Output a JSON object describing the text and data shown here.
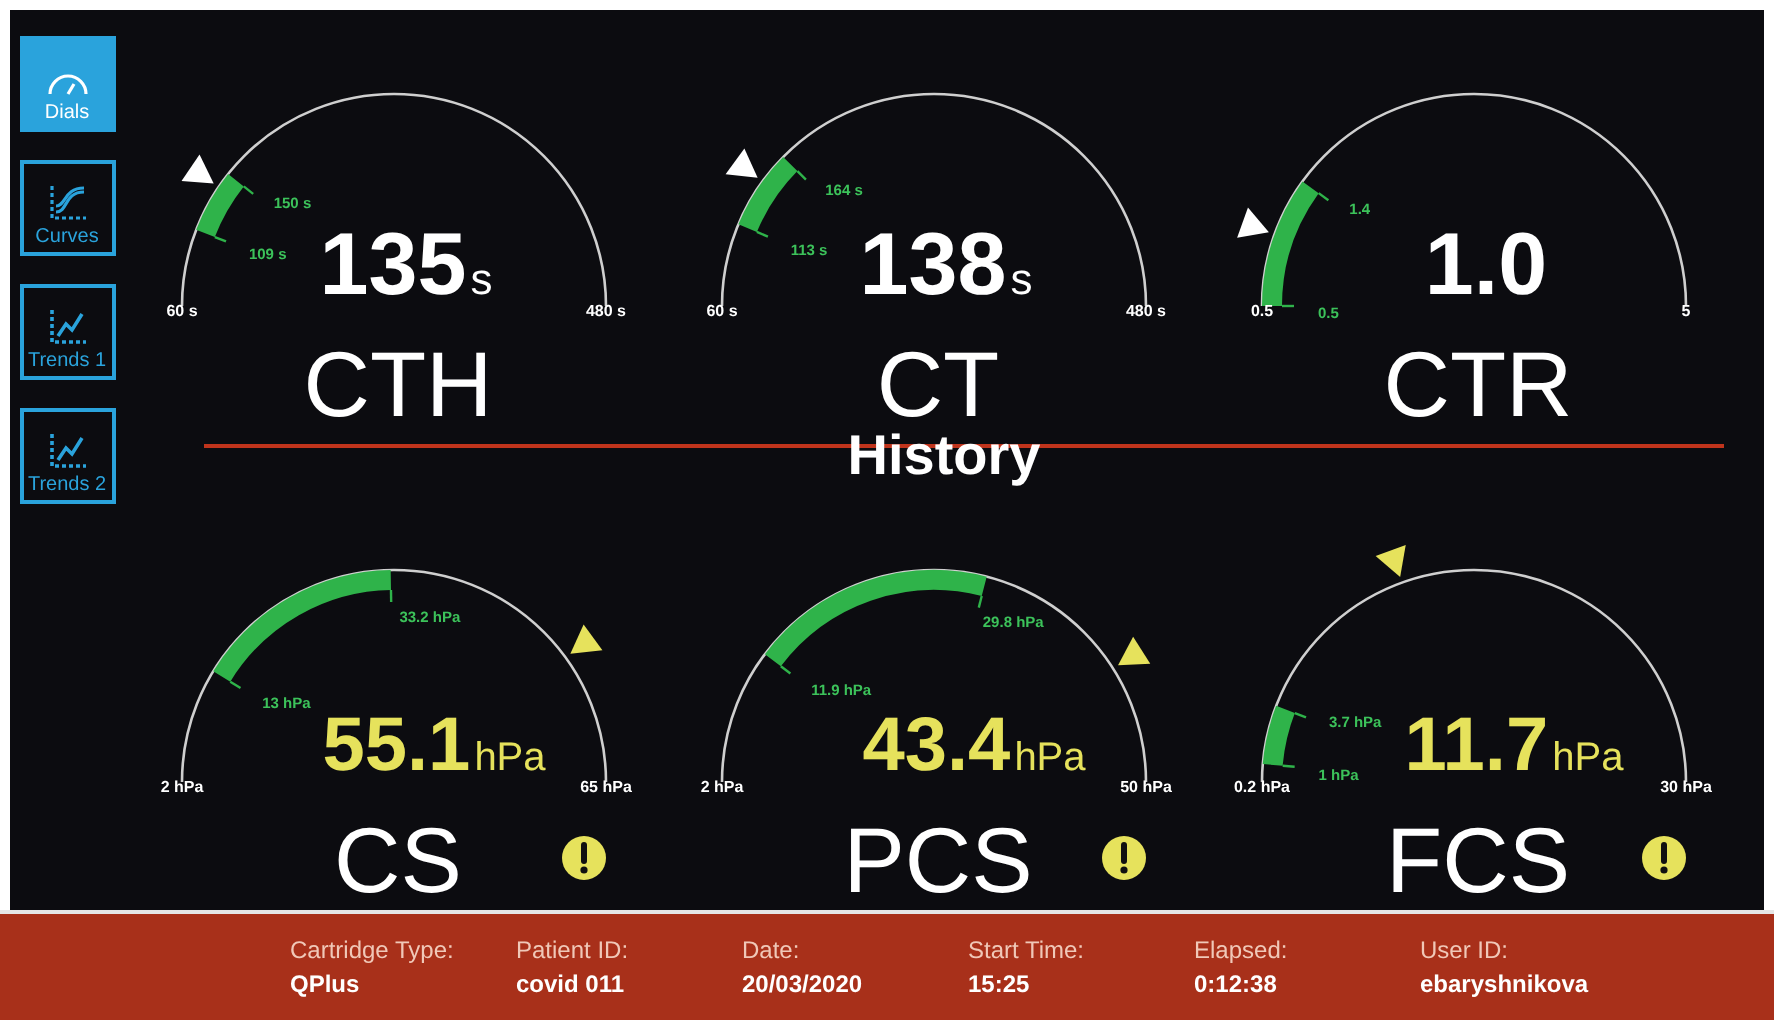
{
  "sidebar": {
    "items": [
      {
        "label": "Dials",
        "kind": "dials",
        "selected": true
      },
      {
        "label": "Curves",
        "kind": "curves",
        "selected": false
      },
      {
        "label": "Trends 1",
        "kind": "trends",
        "selected": false
      },
      {
        "label": "Trends 2",
        "kind": "trends",
        "selected": false
      }
    ]
  },
  "dials_top": [
    {
      "name": "CTH",
      "value": "135",
      "unit": "s",
      "min": "60 s",
      "max": "480 s",
      "alert": false,
      "range": {
        "low": "109 s",
        "high": "150 s"
      }
    },
    {
      "name": "CT",
      "value": "138",
      "unit": "s",
      "min": "60 s",
      "max": "480 s",
      "alert": false,
      "range": {
        "low": "113 s",
        "high": "164 s"
      }
    },
    {
      "name": "CTR",
      "value": "1.0",
      "min": "0.5",
      "max": "5",
      "alert": false,
      "range": {
        "low": "0.5",
        "high": "1.4"
      }
    }
  ],
  "divider": {
    "title": "History"
  },
  "dials_bottom": [
    {
      "name": "CS",
      "value": "55.1",
      "unit": "hPa",
      "min": "2 hPa",
      "max": "65 hPa",
      "alert": true,
      "range": {
        "low": "13 hPa",
        "high": "33.2 hPa"
      }
    },
    {
      "name": "PCS",
      "value": "43.4",
      "unit": "hPa",
      "min": "2 hPa",
      "max": "50 hPa",
      "alert": true,
      "range": {
        "low": "11.9 hPa",
        "high": "29.8 hPa"
      }
    },
    {
      "name": "FCS",
      "value": "11.7",
      "unit": "hPa",
      "min": "0.2 hPa",
      "max": "30 hPa",
      "alert": true,
      "range": {
        "low": "1 hPa",
        "high": "3.7 hPa"
      }
    }
  ],
  "status_bar": [
    {
      "label": "Cartridge Type:",
      "value": "QPlus"
    },
    {
      "label": "Patient ID:",
      "value": "covid 011"
    },
    {
      "label": "Date:",
      "value": "20/03/2020"
    },
    {
      "label": "Start Time:",
      "value": "15:25"
    },
    {
      "label": "Elapsed:",
      "value": "0:12:38"
    },
    {
      "label": "User ID:",
      "value": "ebaryshnikova"
    }
  ]
}
